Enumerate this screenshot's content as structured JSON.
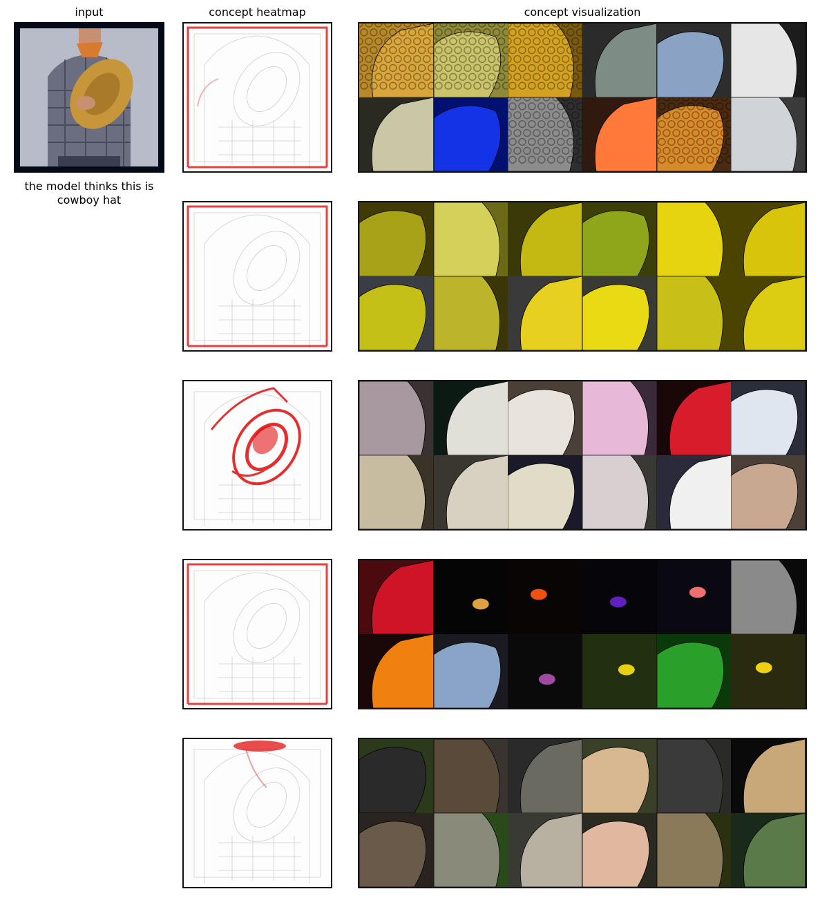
{
  "headers": {
    "input": "input",
    "heatmap": "concept heatmap",
    "visualization": "concept visualization"
  },
  "caption": "the model thinks this is cowboy hat",
  "rows": [
    {
      "heat_level": "edges",
      "tiles": [
        {
          "bg": "#b8892a",
          "fg": "#d9a63c",
          "pattern": "honeycomb"
        },
        {
          "bg": "#8f8a3a",
          "fg": "#c9c36a",
          "pattern": "honeycomb"
        },
        {
          "bg": "#7a5a10",
          "fg": "#d4a222",
          "pattern": "honeycomb"
        },
        {
          "bg": "#2b2b2b",
          "fg": "#7e8c86",
          "pattern": "curve"
        },
        {
          "bg": "#2d2d2d",
          "fg": "#8aa2c4",
          "pattern": "curve"
        },
        {
          "bg": "#1c1c1c",
          "fg": "#e6e6e6",
          "pattern": "curve"
        },
        {
          "bg": "#2a2a22",
          "fg": "#c9c7a6",
          "pattern": "curve"
        },
        {
          "bg": "#021070",
          "fg": "#1432e6",
          "pattern": "curve"
        },
        {
          "bg": "#2e2e2e",
          "fg": "#8c8c8c",
          "pattern": "honeycomb"
        },
        {
          "bg": "#301a10",
          "fg": "#ff7a3a",
          "pattern": "curve"
        },
        {
          "bg": "#4a2a10",
          "fg": "#d88a2a",
          "pattern": "honeycomb"
        },
        {
          "bg": "#3a3a3a",
          "fg": "#d0d4d8",
          "pattern": "curve"
        }
      ]
    },
    {
      "heat_level": "edges",
      "tiles": [
        {
          "bg": "#3f3a06",
          "fg": "#a8a218",
          "pattern": "curve"
        },
        {
          "bg": "#6b6a16",
          "fg": "#d4d05a",
          "pattern": "curve"
        },
        {
          "bg": "#3a3a08",
          "fg": "#c4b812",
          "pattern": "curve"
        },
        {
          "bg": "#3e3e08",
          "fg": "#8fa61a",
          "pattern": "curve"
        },
        {
          "bg": "#4a4400",
          "fg": "#e6d410",
          "pattern": "curve"
        },
        {
          "bg": "#4a4400",
          "fg": "#d9c40c",
          "pattern": "curve"
        },
        {
          "bg": "#3a3e44",
          "fg": "#c4c018",
          "pattern": "curve"
        },
        {
          "bg": "#3a3608",
          "fg": "#bcb42a",
          "pattern": "curve"
        },
        {
          "bg": "#3a3a3a",
          "fg": "#e8d020",
          "pattern": "curve"
        },
        {
          "bg": "#3a3a34",
          "fg": "#eada14",
          "pattern": "curve"
        },
        {
          "bg": "#4a4400",
          "fg": "#c8c016",
          "pattern": "curve"
        },
        {
          "bg": "#4a4400",
          "fg": "#dccc12",
          "pattern": "curve"
        }
      ]
    },
    {
      "heat_level": "strong",
      "tiles": [
        {
          "bg": "#3a3232",
          "fg": "#a898a0",
          "pattern": "curve"
        },
        {
          "bg": "#0c1a14",
          "fg": "#e0e0d8",
          "pattern": "curve"
        },
        {
          "bg": "#4a4038",
          "fg": "#e8e4dc",
          "pattern": "curve"
        },
        {
          "bg": "#3a2a3a",
          "fg": "#e8b8d8",
          "pattern": "curve"
        },
        {
          "bg": "#1a0808",
          "fg": "#d81c2c",
          "pattern": "curve"
        },
        {
          "bg": "#2a2e3a",
          "fg": "#e0e6f0",
          "pattern": "curve"
        },
        {
          "bg": "#3a3428",
          "fg": "#c8bca0",
          "pattern": "curve"
        },
        {
          "bg": "#3a3630",
          "fg": "#d8d0c0",
          "pattern": "curve"
        },
        {
          "bg": "#1a1a2a",
          "fg": "#e0dcc8",
          "pattern": "curve"
        },
        {
          "bg": "#3a3834",
          "fg": "#d8d0d0",
          "pattern": "curve"
        },
        {
          "bg": "#2a2a3a",
          "fg": "#f0f0f0",
          "pattern": "curve"
        },
        {
          "bg": "#4a4038",
          "fg": "#c8a890",
          "pattern": "curve"
        }
      ]
    },
    {
      "heat_level": "edges",
      "tiles": [
        {
          "bg": "#4a0a0e",
          "fg": "#d01428",
          "pattern": "curve"
        },
        {
          "bg": "#050505",
          "fg": "#e0a040",
          "pattern": "dot"
        },
        {
          "bg": "#0a0505",
          "fg": "#f05010",
          "pattern": "dot"
        },
        {
          "bg": "#05050a",
          "fg": "#6020c0",
          "pattern": "dot"
        },
        {
          "bg": "#0a0810",
          "fg": "#f07070",
          "pattern": "dot"
        },
        {
          "bg": "#0a0a0a",
          "fg": "#8a8a8a",
          "pattern": "curve"
        },
        {
          "bg": "#1a0808",
          "fg": "#f08010",
          "pattern": "curve"
        },
        {
          "bg": "#1a1a20",
          "fg": "#8aa4c8",
          "pattern": "curve"
        },
        {
          "bg": "#0a0a0a",
          "fg": "#a04aa0",
          "pattern": "dot"
        },
        {
          "bg": "#203010",
          "fg": "#e8d010",
          "pattern": "dot"
        },
        {
          "bg": "#0a3a0a",
          "fg": "#2aa02a",
          "pattern": "curve"
        },
        {
          "bg": "#2a2a10",
          "fg": "#f0d010",
          "pattern": "dot"
        }
      ]
    },
    {
      "heat_level": "top",
      "tiles": [
        {
          "bg": "#2a3a1a",
          "fg": "#2a2a2a",
          "pattern": "curve"
        },
        {
          "bg": "#3a3430",
          "fg": "#5a4a3a",
          "pattern": "curve"
        },
        {
          "bg": "#2a2a2a",
          "fg": "#6a6a60",
          "pattern": "curve"
        },
        {
          "bg": "#3a4028",
          "fg": "#d8b890",
          "pattern": "curve"
        },
        {
          "bg": "#2a2a28",
          "fg": "#3a3a3a",
          "pattern": "curve"
        },
        {
          "bg": "#0a0a0a",
          "fg": "#c8a878",
          "pattern": "curve"
        },
        {
          "bg": "#2a2420",
          "fg": "#6a5a4a",
          "pattern": "curve"
        },
        {
          "bg": "#2a4a1a",
          "fg": "#8a8a7a",
          "pattern": "curve"
        },
        {
          "bg": "#3a3a34",
          "fg": "#b8b0a0",
          "pattern": "curve"
        },
        {
          "bg": "#2a2a20",
          "fg": "#e0b8a0",
          "pattern": "curve"
        },
        {
          "bg": "#2a3010",
          "fg": "#8a7a5a",
          "pattern": "curve"
        },
        {
          "bg": "#1a2a1a",
          "fg": "#5a7a4a",
          "pattern": "curve"
        }
      ]
    }
  ]
}
